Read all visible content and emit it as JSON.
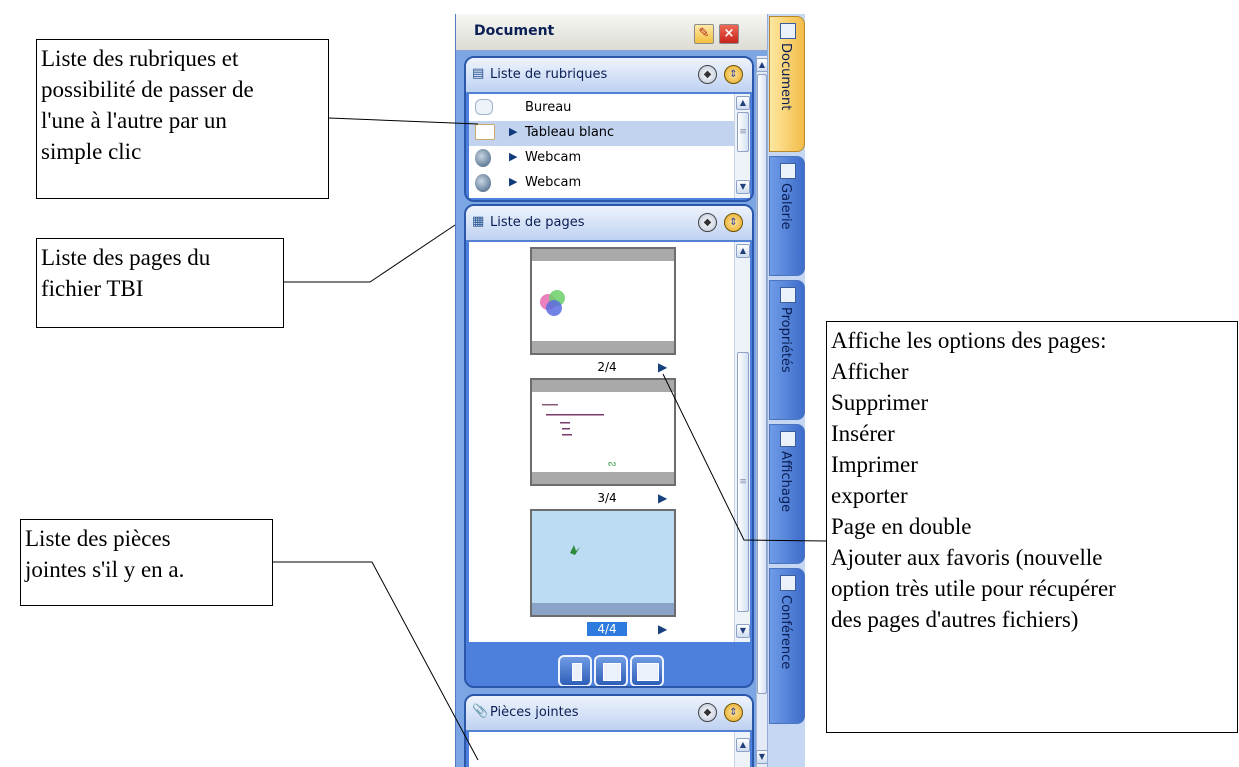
{
  "panel": {
    "title": "Document",
    "pin_icon": "pin-icon",
    "close_icon": "close-icon",
    "rubriques": {
      "title": "Liste de rubriques",
      "items": [
        {
          "label": "Bureau",
          "icon": "desktop-icon",
          "expandable": false,
          "selected": false
        },
        {
          "label": "Tableau blanc",
          "icon": "whiteboard-icon",
          "expandable": true,
          "selected": true
        },
        {
          "label": "Webcam",
          "icon": "webcam-icon",
          "expandable": true,
          "selected": false
        },
        {
          "label": "Webcam",
          "icon": "webcam-icon",
          "expandable": true,
          "selected": false
        }
      ]
    },
    "pages": {
      "title": "Liste de pages",
      "items": [
        {
          "label": "2/4",
          "current": false
        },
        {
          "label": "3/4",
          "current": false
        },
        {
          "label": "4/4",
          "current": true
        }
      ],
      "view_buttons": [
        "single-column-view-icon",
        "single-page-view-icon",
        "wide-page-view-icon"
      ]
    },
    "pieces": {
      "title": "Pièces jointes"
    }
  },
  "tabs": [
    {
      "label": "Document",
      "icon": "document-tab-icon",
      "active": true
    },
    {
      "label": "Galerie",
      "icon": "gallery-tab-icon",
      "active": false
    },
    {
      "label": "Propriétés",
      "icon": "properties-tab-icon",
      "active": false
    },
    {
      "label": "Affichage",
      "icon": "display-tab-icon",
      "active": false
    },
    {
      "label": "Conférence",
      "icon": "conference-tab-icon",
      "active": false
    }
  ],
  "callouts": {
    "rubriques": [
      "Liste des rubriques et",
      "possibilité de passer de",
      "l'une à l'autre par un",
      "simple clic"
    ],
    "pages": [
      "Liste des pages du",
      "fichier TBI"
    ],
    "pieces": [
      "Liste des pièces",
      "jointes s'il y en a."
    ],
    "options": [
      "Affiche les options des pages:",
      "Afficher",
      "Supprimer",
      "Insérer",
      "Imprimer",
      "exporter",
      "Page en double",
      "Ajouter aux favoris (nouvelle",
      "option très utile pour récupérer",
      "des pages d'autres fichiers)"
    ]
  }
}
